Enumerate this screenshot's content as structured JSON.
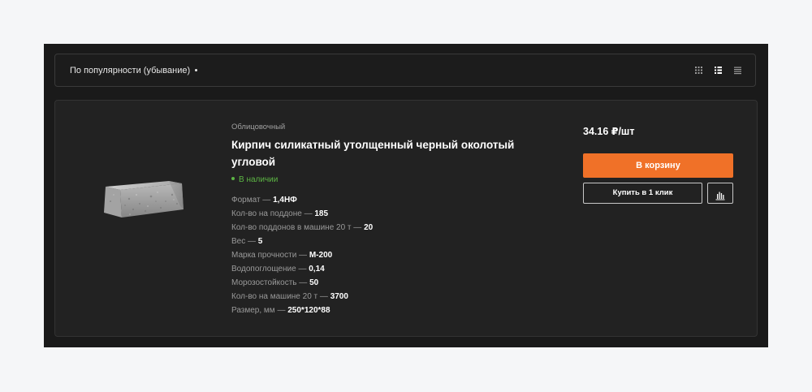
{
  "sort": {
    "label": "По популярности (убывание)"
  },
  "view_modes": [
    "grid-icon",
    "list-detailed-icon",
    "list-icon"
  ],
  "product": {
    "category": "Облицовочный",
    "title": "Кирпич силикатный утолщенный черный околотый угловой",
    "stock": "В наличии",
    "specs": [
      {
        "label": "Формат",
        "value": "1,4НФ"
      },
      {
        "label": "Кол-во на поддоне",
        "value": "185"
      },
      {
        "label": "Кол-во поддонов в машине 20 т",
        "value": "20"
      },
      {
        "label": "Вес",
        "value": "5"
      },
      {
        "label": "Марка прочности",
        "value": "М-200"
      },
      {
        "label": "Водопоглощение",
        "value": "0,14"
      },
      {
        "label": "Морозостойкость",
        "value": "50"
      },
      {
        "label": "Кол-во на машине 20 т",
        "value": "3700"
      },
      {
        "label": "Размер, мм",
        "value": "250*120*88"
      }
    ],
    "price": "34.16 ₽/шт",
    "cart_label": "В корзину",
    "oneclick_label": "Купить в 1 клик"
  },
  "colors": {
    "accent": "#f07128",
    "in_stock": "#5cb544",
    "panel": "#1a1a1a",
    "card": "#222222"
  }
}
